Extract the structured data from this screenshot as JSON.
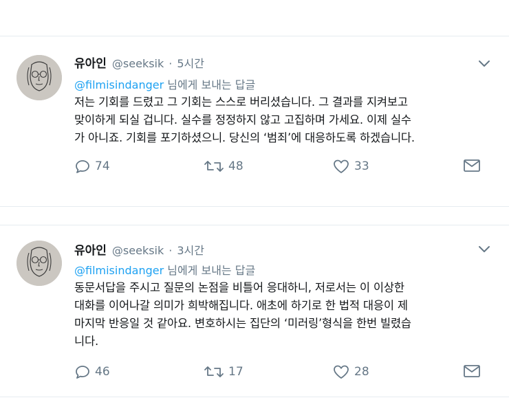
{
  "tweets": [
    {
      "name": "유아인",
      "handle": "@seeksik",
      "dot": "·",
      "time": "5시간",
      "reply_mention": "@filmisindanger",
      "reply_suffix": " 님에게 보내는 답글",
      "lines": [
        "저는 기회를 드렸고 그 기회는 스스로 버리셨습니다. 그 결과를 지켜보고",
        "맞이하게 되실 겁니다. 실수를 정정하지 않고 고집하며 가세요. 이제 실수",
        "가 아니죠. 기회를 포기하셨으니. 당신의 ‘범죄’에 대응하도록 하겠습니다."
      ],
      "replies": "74",
      "retweets": "48",
      "likes": "33"
    },
    {
      "name": "유아인",
      "handle": "@seeksik",
      "dot": "·",
      "time": "3시간",
      "reply_mention": "@filmisindanger",
      "reply_suffix": " 님에게 보내는 답글",
      "lines": [
        "동문서답을 주시고 질문의 논점을 비틀어 응대하니, 저로서는 이 이상한",
        "대화를 이어나갈 의미가 희박해집니다. 애초에 하기로 한 법적 대응이 제",
        "마지막 반응일 것 같아요. 변호하시는 집단의 ‘미러링’형식을 한번 빌렸습",
        "니다."
      ],
      "replies": "46",
      "retweets": "17",
      "likes": "28"
    }
  ],
  "icons": {
    "more": "chevron-down-icon",
    "reply": "reply-icon",
    "retweet": "retweet-icon",
    "like": "heart-icon",
    "dm": "envelope-icon"
  },
  "colors": {
    "text": "#14171a",
    "muted": "#657786",
    "link": "#1da1f2",
    "divider": "#e6ecf0"
  }
}
